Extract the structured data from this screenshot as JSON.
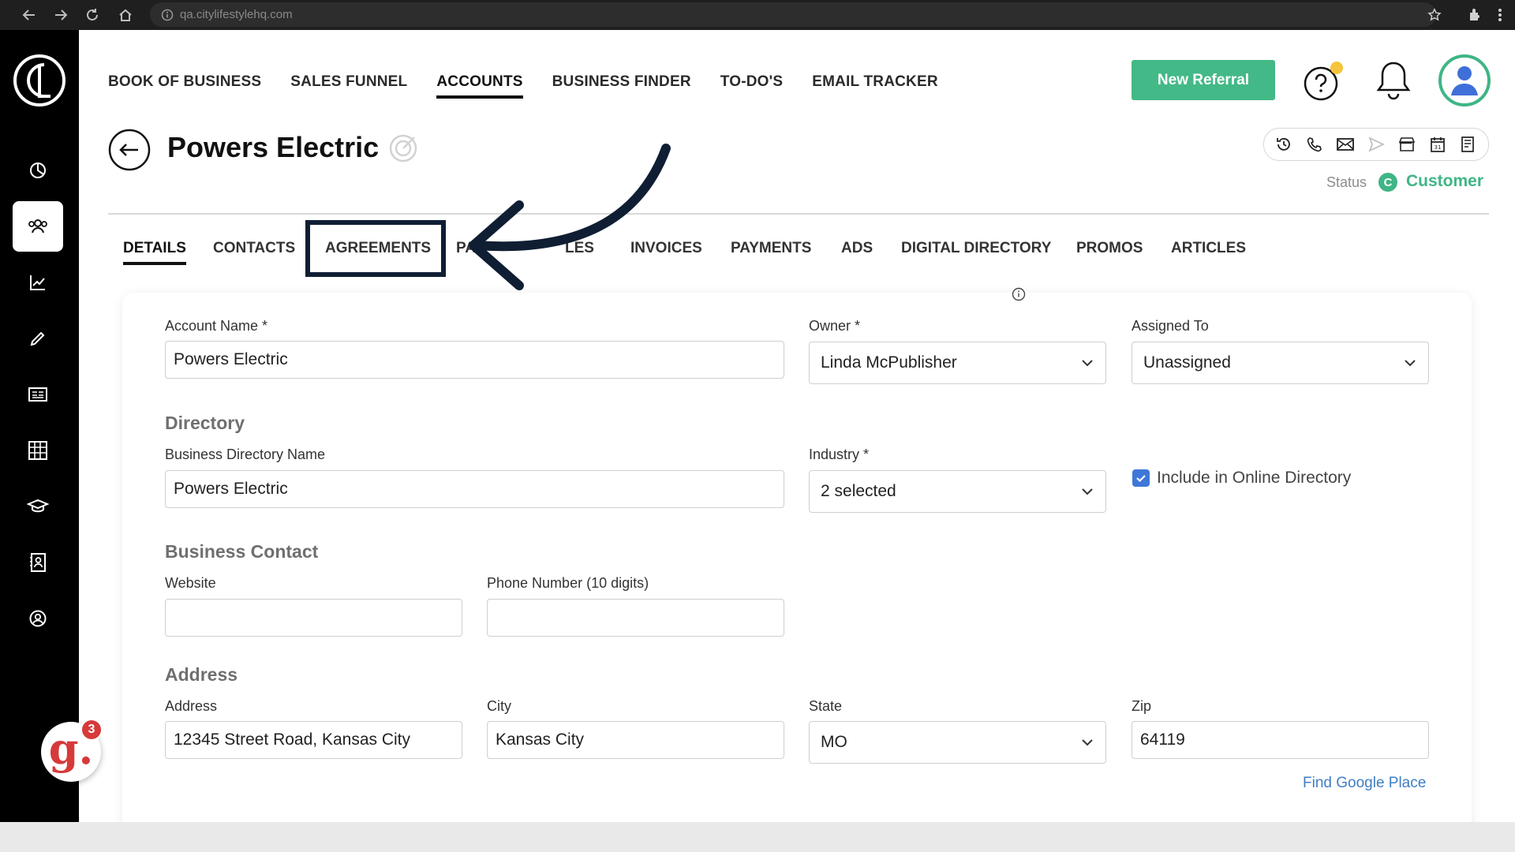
{
  "browser": {
    "url": "qa.citylifestylehq.com"
  },
  "top_nav": {
    "items": [
      "BOOK OF BUSINESS",
      "SALES FUNNEL",
      "ACCOUNTS",
      "BUSINESS FINDER",
      "TO-DO'S",
      "EMAIL TRACKER"
    ],
    "active": "ACCOUNTS"
  },
  "header": {
    "new_referral_label": "New Referral"
  },
  "account": {
    "title": "Powers Electric",
    "status_label": "Status",
    "status_icon_letter": "C",
    "status_value": "Customer"
  },
  "tabs": {
    "items": [
      "DETAILS",
      "CONTACTS",
      "AGREEMENTS",
      "PA",
      "LES",
      "INVOICES",
      "PAYMENTS",
      "ADS",
      "DIGITAL DIRECTORY",
      "PROMOS",
      "ARTICLES"
    ],
    "active": "DETAILS",
    "highlighted": "AGREEMENTS"
  },
  "form": {
    "account_name_label": "Account Name *",
    "account_name_value": "Powers Electric",
    "owner_label": "Owner *",
    "owner_value": "Linda McPublisher",
    "assigned_label": "Assigned To",
    "assigned_value": "Unassigned",
    "directory_heading": "Directory",
    "directory_name_label": "Business Directory Name",
    "directory_name_value": "Powers Electric",
    "industry_label": "Industry *",
    "industry_value": "2 selected",
    "include_directory_label": "Include in Online Directory",
    "include_directory_checked": true,
    "contact_heading": "Business Contact",
    "website_label": "Website",
    "website_value": "",
    "phone_label": "Phone Number (10 digits)",
    "phone_value": "",
    "address_heading": "Address",
    "address_label": "Address",
    "address_value": "12345 Street Road, Kansas City",
    "city_label": "City",
    "city_value": "Kansas City",
    "state_label": "State",
    "state_value": "MO",
    "zip_label": "Zip",
    "zip_value": "64119",
    "google_link": "Find Google Place"
  },
  "widget": {
    "letter": "g.",
    "badge_count": "3"
  },
  "colors": {
    "accent_green": "#43b987",
    "link_blue": "#3f7fc3",
    "checkbox_blue": "#3d78d8",
    "highlight_navy": "#0f1e33"
  }
}
